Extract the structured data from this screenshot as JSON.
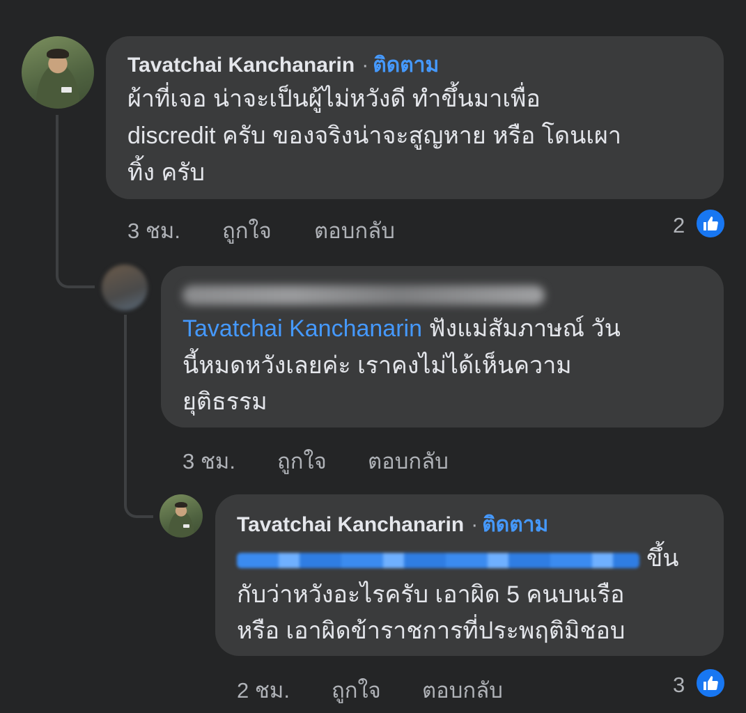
{
  "comments": [
    {
      "author": "Tavatchai Kanchanarin",
      "separator": "·",
      "follow": "ติดตาม",
      "lines": [
        "ผ้าที่เจอ น่าจะเป็นผู้ไม่หวังดี ทำขึ้นมาเพื่อ",
        "discredit ครับ ของจริงน่าจะสูญหาย หรือ โดนเผา",
        "ทิ้ง ครับ"
      ],
      "time": "3 ชม.",
      "like_action": "ถูกใจ",
      "reply_action": "ตอบกลับ",
      "like_count": "2"
    },
    {
      "mention": "Tavatchai Kanchanarin",
      "lines": [
        " ฟังแม่สัมภาษณ์ วัน",
        "นี้หมดหวังเลยค่ะ  เราคงไม่ได้เห็นความ",
        "ยุติธรรม"
      ],
      "time": "3 ชม.",
      "like_action": "ถูกใจ",
      "reply_action": "ตอบกลับ"
    },
    {
      "author": "Tavatchai Kanchanarin",
      "separator": "·",
      "follow": "ติดตาม",
      "lines": [
        "ขึ้น",
        "กับว่าหวังอะไรครับ เอาผิด 5 คนบนเรือ",
        "หรือ เอาผิดข้าราชการที่ประพฤติมิชอบ"
      ],
      "time": "2 ชม.",
      "like_action": "ถูกใจ",
      "reply_action": "ตอบกลับ",
      "like_count": "3"
    }
  ],
  "colors": {
    "background": "#242526",
    "bubble": "#3a3b3c",
    "link": "#4599ff",
    "like_icon": "#1877f2"
  },
  "icons": [
    "thumbs-up-icon"
  ]
}
